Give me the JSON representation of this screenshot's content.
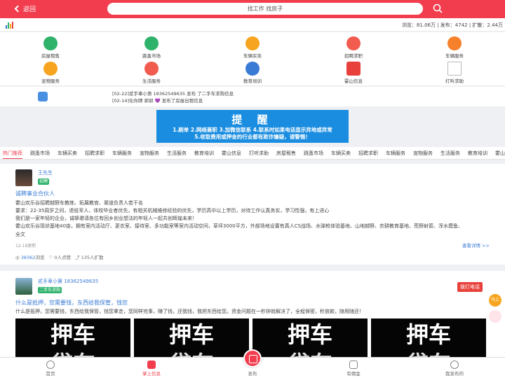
{
  "header": {
    "back_label": "返回",
    "search_text": "找工作 找房子"
  },
  "stats": {
    "text": "浏览：81.06万 | 发布：4742 | 扩散：2.44万"
  },
  "categories": [
    {
      "label": "房屋租售",
      "icon": "house-icon",
      "color": "#2fb36b"
    },
    {
      "label": "跳蚤市场",
      "icon": "gift-icon",
      "color": "#2fb36b"
    },
    {
      "label": "车辆买卖",
      "icon": "car-icon",
      "color": "#f7a520"
    },
    {
      "label": "招聘求职",
      "icon": "briefcase-icon",
      "color": "#f25c4e"
    },
    {
      "label": "车辆服务",
      "icon": "car-service-icon",
      "color": "#f7802a"
    },
    {
      "label": "宠物服务",
      "icon": "pet-icon",
      "color": "#f7a520"
    },
    {
      "label": "生活服务",
      "icon": "life-icon",
      "color": "#f25c4e"
    },
    {
      "label": "教育培训",
      "icon": "graduation-cap-icon",
      "color": "#3a7bd5"
    },
    {
      "label": "霍山信息",
      "icon": "info-icon",
      "color": "#e8413b"
    },
    {
      "label": "打听求助",
      "icon": "help-icon",
      "color": "#ffffff"
    }
  ],
  "notices": [
    "[02-22]贰手車小第 18362549635 发布 了二手车求购信息",
    "[02-14]化你牌 郭郭 💜 发布了房屋出租信息"
  ],
  "banner": {
    "title": "提 醒",
    "line1": "1.刷单  2.网络兼职  3.加微信联系  4.联系时如果电话显示异地或异常",
    "line2": "5.收取费用或押金的行业都有欺诈嫌疑，请警惕！"
  },
  "tabs": [
    "热门推荐",
    "跳蚤市场",
    "车辆买卖",
    "招聘求职",
    "车辆服务",
    "宠物服务",
    "生活服务",
    "教育培训",
    "霍山信息",
    "打听求助",
    "房屋租售",
    "跳蚤市场",
    "车辆买卖",
    "招聘求职",
    "车辆服务",
    "宠物服务",
    "生活服务",
    "教育培训",
    "霍山信息",
    "打"
  ],
  "post1": {
    "name": "王先生",
    "tag": "招聘",
    "title": "诚聘事业合伙人",
    "lines": [
      "霍山欢乐谷招聘越野车教练、拓展教官、渠道负责人若干名",
      "要求：22-35周岁之间，退役军人、体校毕业者优先，有相关机械维修经验的优先，学历高中以上学历，对待工作认真务实，学习性强，有上进心",
      "我们是一家年轻的企业，诚挚邀请各位有回乡创业想法的年轻人一起共创辉煌未来！",
      "霍山欢乐谷现状基地40亩，拥有室内活动厅、更衣室、接待室、多功能室等室内活动空间，草坪3000平方，外部场地设置有真人CS战场、水弹枪体验基地、山地越野、农耕教育基地、荒野射箭、浑水摸鱼、",
      "全文"
    ],
    "time": "12-18更新",
    "detail": "查看详情 >>",
    "views": "38362",
    "views_label": "浏览",
    "likes": "0",
    "likes_label": "人点赞",
    "shares": "135",
    "shares_label": "人扩散"
  },
  "post2": {
    "name": "贰手車小第 18362549635",
    "tag": "二手车求购",
    "call_label": "拨打电话",
    "title": "什么是抵押，您需要钱，东西给我保管，钱您",
    "line": "什么是抵押，您需要钱，东西给我保管，钱您拿走，您同样完事，赚了钱，还我钱，我把东西给您。资金问题在一秒钟就解决了，全程保密，秒放款，随用随还！",
    "image_text": "押车",
    "image_text2": "贷车"
  },
  "side": {
    "badge": "马上"
  },
  "bottom_nav": [
    {
      "label": "首页"
    },
    {
      "label": "掌上信息"
    },
    {
      "label": "发布"
    },
    {
      "label": "有佣金"
    },
    {
      "label": "我发布的"
    }
  ]
}
